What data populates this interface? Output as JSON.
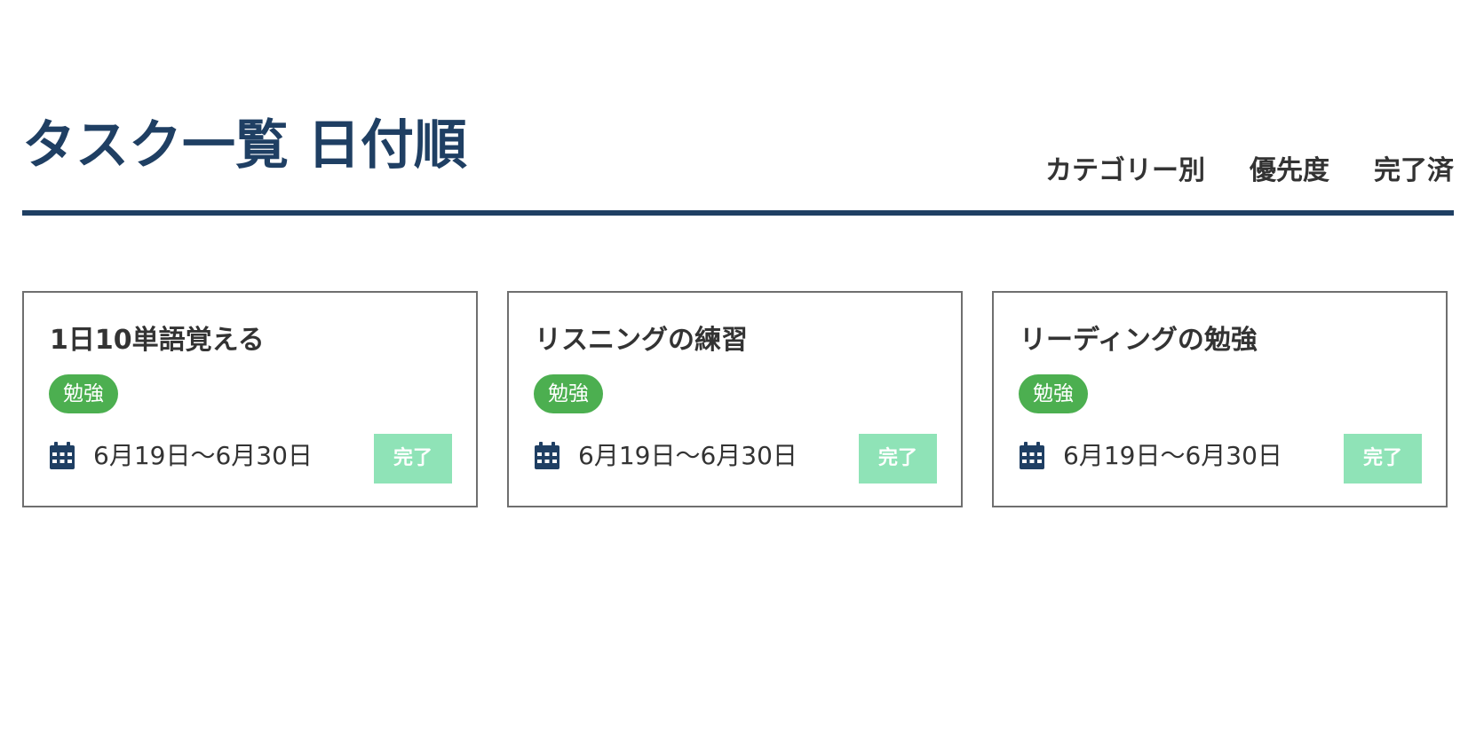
{
  "header": {
    "title": "タスク一覧 日付順",
    "nav": [
      {
        "label": "カテゴリー別"
      },
      {
        "label": "優先度"
      },
      {
        "label": "完了済"
      }
    ]
  },
  "tasks": [
    {
      "title": "1日10単語覚える",
      "category": "勉強",
      "date_range": "6月19日〜6月30日",
      "complete_label": "完了"
    },
    {
      "title": "リスニングの練習",
      "category": "勉強",
      "date_range": "6月19日〜6月30日",
      "complete_label": "完了"
    },
    {
      "title": "リーディングの勉強",
      "category": "勉強",
      "date_range": "6月19日〜6月30日",
      "complete_label": "完了"
    }
  ],
  "colors": {
    "primary": "#1f3f63",
    "category_badge": "#4caf50",
    "complete_button": "#8fe3b7",
    "card_border": "#6f6f6f"
  },
  "icons": {
    "calendar": "calendar-icon"
  }
}
